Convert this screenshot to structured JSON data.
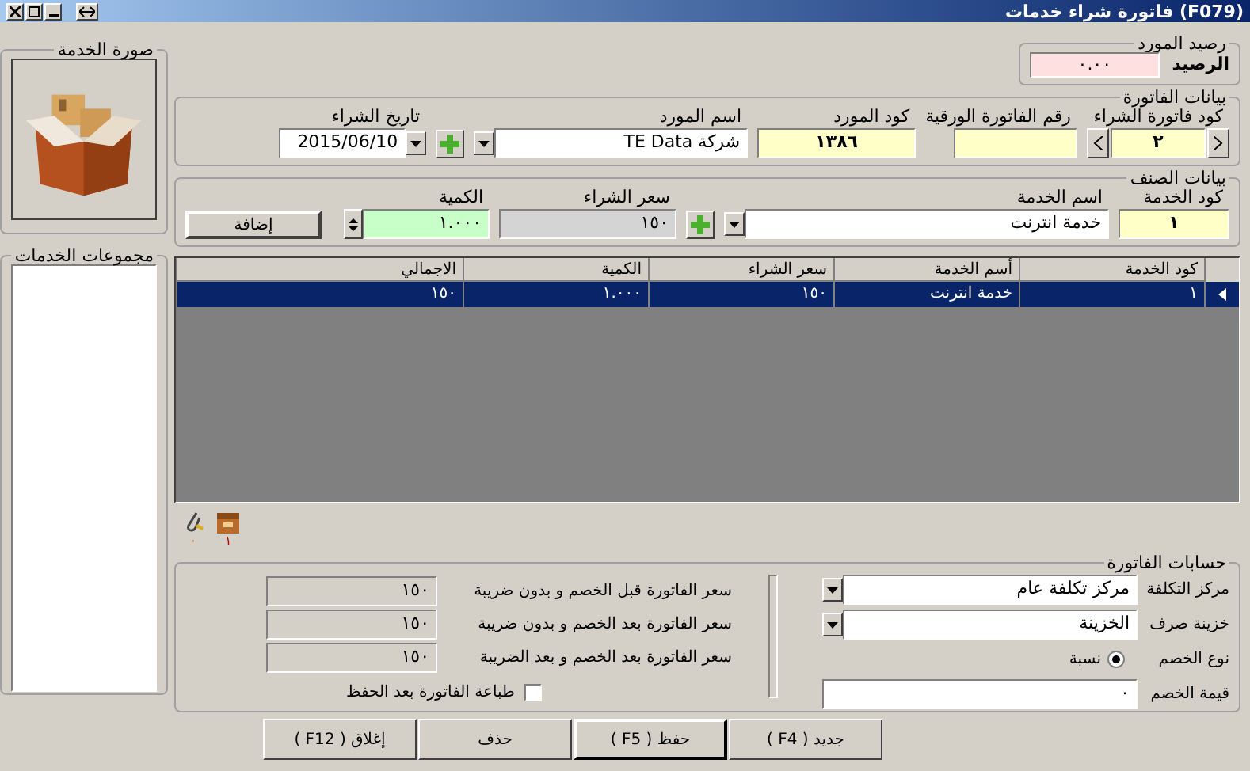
{
  "window": {
    "title": "(F079) فاتورة شراء خدمات"
  },
  "balance": {
    "group_title": "رصيد المورد",
    "label": "الرصيد",
    "value": "٠.٠٠"
  },
  "invoice": {
    "group_title": "بيانات الفاتورة",
    "purchase_code": {
      "label": "كود فاتورة الشراء",
      "value": "٢"
    },
    "paper_number": {
      "label": "رقم الفاتورة الورقية"
    },
    "supplier_code": {
      "label": "كود المورد",
      "value": "١٣٨٦"
    },
    "supplier_name": {
      "label": "اسم المورد",
      "value": "شركة TE Data"
    },
    "purchase_date": {
      "label": "تاريخ الشراء",
      "value": "2015/06/10"
    }
  },
  "item": {
    "group_title": "بيانات الصنف",
    "service_code": {
      "label": "كود الخدمة",
      "value": "١"
    },
    "service_name": {
      "label": "اسم الخدمة",
      "value": "خدمة انترنت"
    },
    "price": {
      "label": "سعر الشراء",
      "value": "١٥٠"
    },
    "quantity": {
      "label": "الكمية",
      "value": "١.٠٠٠"
    },
    "add_button": "إضافة"
  },
  "image_group": {
    "group_title": "صورة الخدمة"
  },
  "groups_list": {
    "group_title": "مجموعات الخدمات"
  },
  "table": {
    "columns": [
      "كود الخدمة",
      "أسم الخدمة",
      "سعر الشراء",
      "الكمية",
      "الاجمالي"
    ],
    "rows": [
      {
        "cells": [
          "١",
          "خدمة انترنت",
          "١٥٠",
          "١.٠٠٠",
          "١٥٠"
        ],
        "selected": true
      }
    ]
  },
  "attachments": [
    {
      "kind": "box",
      "count": "١"
    },
    {
      "kind": "pen",
      "count": "٠"
    }
  ],
  "accounts": {
    "group_title": "حسابات الفاتورة",
    "fields": [
      {
        "kind": "dropdown",
        "label": "مركز التكلفة",
        "value": "مركز تكلفة عام"
      },
      {
        "kind": "dropdown",
        "label": "خزينة صرف",
        "value": "الخزينة"
      },
      {
        "kind": "radio",
        "label": "نوع الخصم",
        "option": "نسبة",
        "selected": true
      },
      {
        "kind": "text",
        "label": "قيمة الخصم",
        "value": "٠"
      }
    ],
    "totals": [
      {
        "label": "سعر الفاتورة قبل الخصم و بدون ضريبة",
        "value": "١٥٠"
      },
      {
        "label": "سعر الفاتورة بعد الخصم و بدون ضريبة",
        "value": "١٥٠"
      },
      {
        "label": "سعر الفاتورة بعد الخصم و بعد الضريبة",
        "value": "١٥٠"
      }
    ],
    "print_after_save": {
      "label": "طباعة الفاتورة بعد الحفظ",
      "checked": false
    }
  },
  "buttons": [
    {
      "label": "جديد ( F4 )",
      "default": false
    },
    {
      "label": "حفظ ( F5 )",
      "default": true
    },
    {
      "label": "حذف",
      "default": false
    },
    {
      "label": "إغلاق ( F12 )",
      "default": false
    }
  ]
}
